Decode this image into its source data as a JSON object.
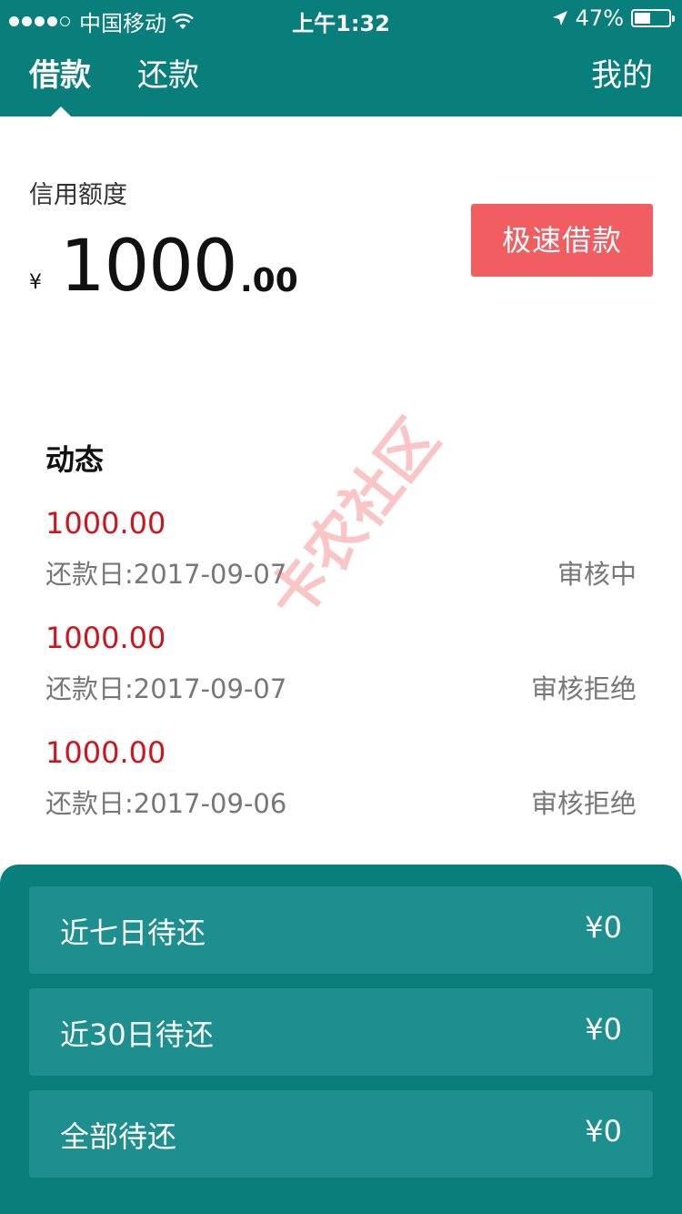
{
  "status_bar": {
    "carrier": "中国移动",
    "time": "上午1:32",
    "battery_percent": "47%",
    "battery_level": 0.47
  },
  "nav": {
    "tabs": [
      {
        "label": "借款",
        "active": true
      },
      {
        "label": "还款",
        "active": false
      }
    ],
    "mine_label": "我的"
  },
  "credit": {
    "label": "信用额度",
    "currency_symbol": "¥",
    "amount_integer": "1000",
    "amount_decimal": ".00",
    "quick_loan_label": "极速借款"
  },
  "activity": {
    "title": "动态",
    "items": [
      {
        "amount": "1000.00",
        "due_date": "还款日:2017-09-07",
        "status": "审核中"
      },
      {
        "amount": "1000.00",
        "due_date": "还款日:2017-09-07",
        "status": "审核拒绝"
      },
      {
        "amount": "1000.00",
        "due_date": "还款日:2017-09-06",
        "status": "审核拒绝"
      }
    ]
  },
  "watermark": "卡农社区",
  "summary": [
    {
      "label": "近七日待还",
      "value": "¥0"
    },
    {
      "label": "近30日待还",
      "value": "¥0"
    },
    {
      "label": "全部待还",
      "value": "¥0"
    }
  ],
  "colors": {
    "primary": "#087f7b",
    "card": "#1e8f8f",
    "accent_button": "#f25d61",
    "amount_red": "#d0141e"
  }
}
